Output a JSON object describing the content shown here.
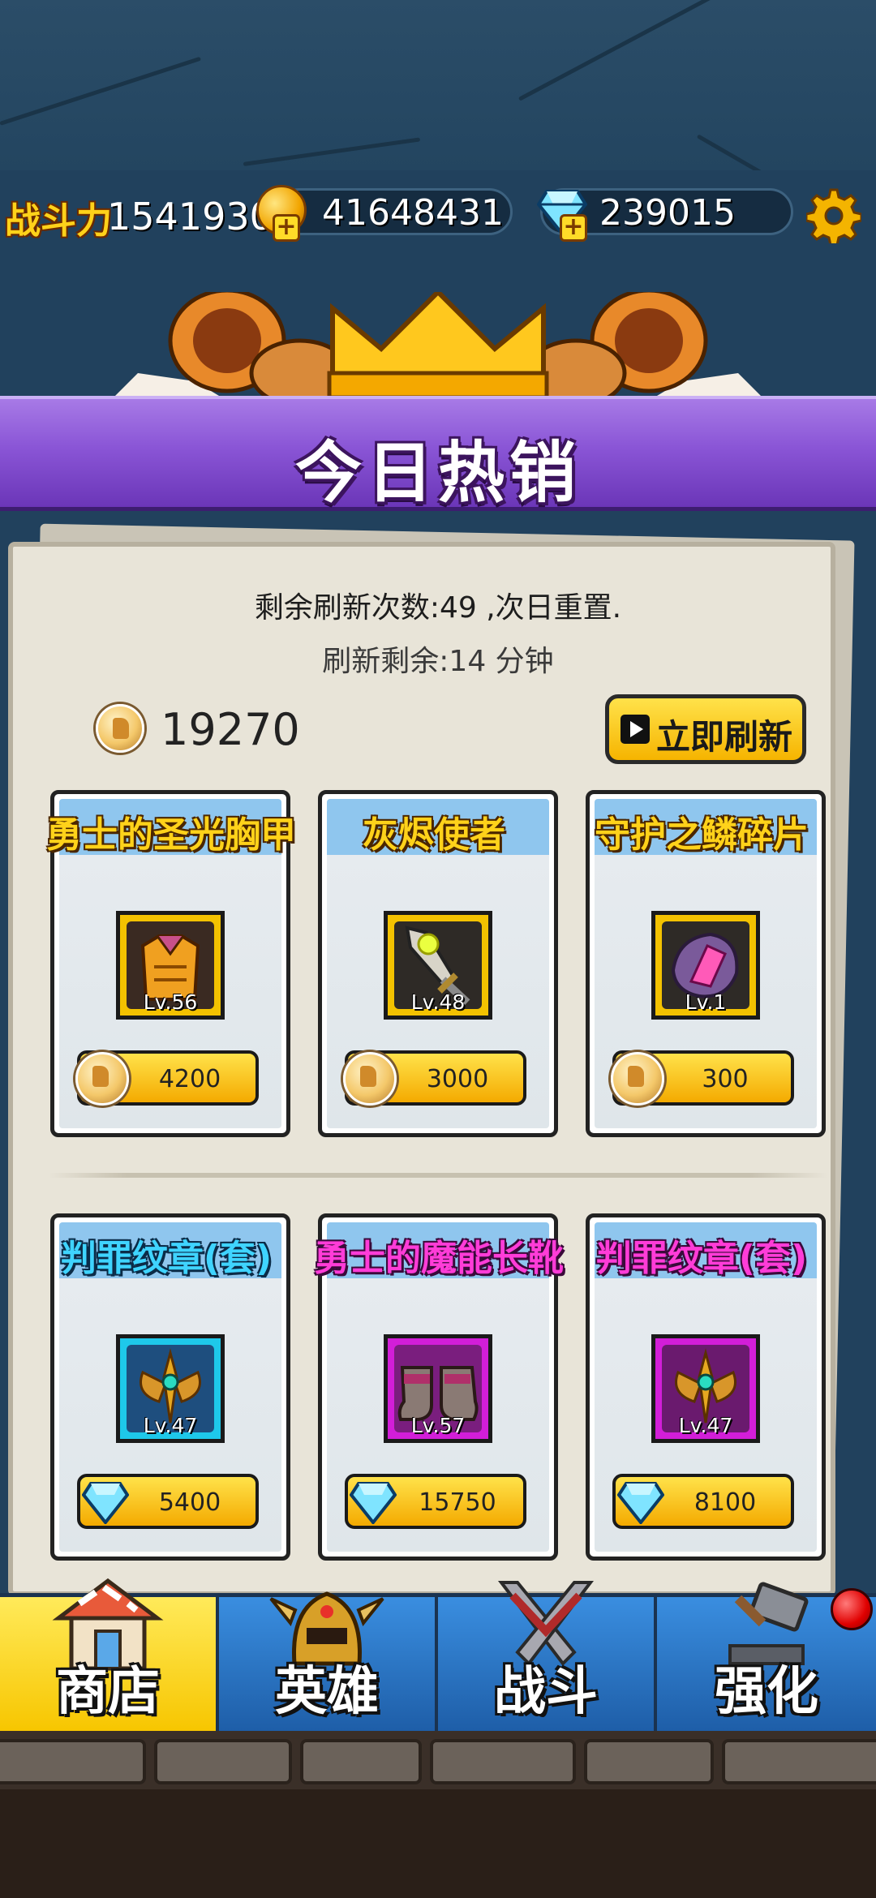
{
  "resources": {
    "power_label": "战斗力",
    "power_value": "1541930",
    "gold_value": "41648431",
    "gem_value": "239015"
  },
  "banner": {
    "title": "今日热销"
  },
  "shop": {
    "refresh_count_text": "剩余刷新次数:49 ,次日重置.",
    "refresh_timer_text": "刷新剩余:14 分钟",
    "token_count": "19270",
    "refresh_button_label": "立即刷新"
  },
  "items": [
    {
      "name": "勇士的圣光胸甲",
      "level": "Lv.56",
      "price": "4200",
      "currency": "token",
      "name_color": "gold",
      "frame": "gold",
      "icon": "chest-armor-icon"
    },
    {
      "name": "灰烬使者",
      "level": "Lv.48",
      "price": "3000",
      "currency": "token",
      "name_color": "gold",
      "frame": "gold",
      "icon": "sword-icon"
    },
    {
      "name": "守护之鳞碎片",
      "level": "Lv.1",
      "price": "300",
      "currency": "token",
      "name_color": "gold",
      "frame": "gold",
      "icon": "scale-shard-icon"
    },
    {
      "name": "判罪纹章(套)",
      "level": "Lv.47",
      "price": "5400",
      "currency": "diamond",
      "name_color": "blue",
      "frame": "cyan",
      "icon": "emblem-icon"
    },
    {
      "name": "勇士的魔能长靴",
      "level": "Lv.57",
      "price": "15750",
      "currency": "diamond",
      "name_color": "pink",
      "frame": "magenta",
      "icon": "boots-icon"
    },
    {
      "name": "判罪纹章(套)",
      "level": "Lv.47",
      "price": "8100",
      "currency": "diamond",
      "name_color": "pink",
      "frame": "magenta",
      "icon": "emblem-icon"
    }
  ],
  "nav": {
    "tabs": [
      {
        "label": "商店",
        "icon": "shop-icon",
        "active": true
      },
      {
        "label": "英雄",
        "icon": "helmet-icon",
        "active": false
      },
      {
        "label": "战斗",
        "icon": "crossed-swords-icon",
        "active": false
      },
      {
        "label": "强化",
        "icon": "hammer-icon",
        "active": false
      }
    ]
  },
  "colors": {
    "accent_gold": "#ffd21a",
    "banner_purple": "#8a55d6",
    "nav_blue": "#2f6fb8",
    "active_tab_yellow": "#f7c600"
  }
}
